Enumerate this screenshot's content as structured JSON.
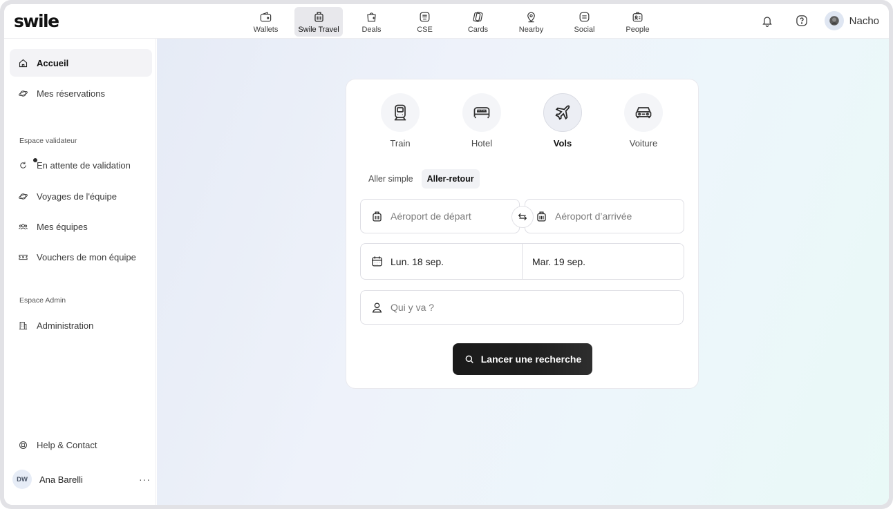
{
  "app": {
    "logo": "swile"
  },
  "topnav": {
    "items": [
      {
        "label": "Wallets",
        "icon": "wallet-icon"
      },
      {
        "label": "Swile Travel",
        "icon": "luggage-icon",
        "active": true
      },
      {
        "label": "Deals",
        "icon": "shopping-bag-icon"
      },
      {
        "label": "CSE",
        "icon": "cse-icon"
      },
      {
        "label": "Cards",
        "icon": "cards-icon"
      },
      {
        "label": "Nearby",
        "icon": "location-pin-icon"
      },
      {
        "label": "Social",
        "icon": "social-icon"
      },
      {
        "label": "People",
        "icon": "people-icon"
      }
    ],
    "user_name": "Nacho"
  },
  "sidebar": {
    "items": [
      {
        "label": "Accueil",
        "icon": "home-icon",
        "active": true
      },
      {
        "label": "Mes réservations",
        "icon": "planet-icon"
      }
    ],
    "validator_section": "Espace validateur",
    "validator_items": [
      {
        "label": "En attente de validation",
        "icon": "refresh-icon"
      },
      {
        "label": "Voyages de l'équipe",
        "icon": "planet-icon"
      },
      {
        "label": "Mes équipes",
        "icon": "team-icon"
      },
      {
        "label": "Vouchers de mon équipe",
        "icon": "voucher-icon"
      }
    ],
    "admin_section": "Espace Admin",
    "admin_items": [
      {
        "label": "Administration",
        "icon": "building-icon"
      }
    ],
    "help": "Help & Contact",
    "user": {
      "initials": "DW",
      "name": "Ana Barelli",
      "more": "···"
    }
  },
  "search": {
    "modes": [
      {
        "label": "Train",
        "icon": "train-icon"
      },
      {
        "label": "Hotel",
        "icon": "bed-icon"
      },
      {
        "label": "Vols",
        "icon": "plane-icon",
        "active": true
      },
      {
        "label": "Voiture",
        "icon": "car-icon"
      }
    ],
    "trip_types": [
      {
        "label": "Aller simple"
      },
      {
        "label": "Aller-retour",
        "active": true
      }
    ],
    "departure_placeholder": "Aéroport de départ",
    "arrival_placeholder": "Aéroport d’arrivée",
    "date_out": "Lun. 18 sep.",
    "date_return": "Mar. 19 sep.",
    "travellers_placeholder": "Qui y va ?",
    "submit_label": "Lancer une recherche"
  },
  "colors": {
    "accent_dark": "#1a1a1a",
    "active_bg": "#e8e8ec"
  }
}
